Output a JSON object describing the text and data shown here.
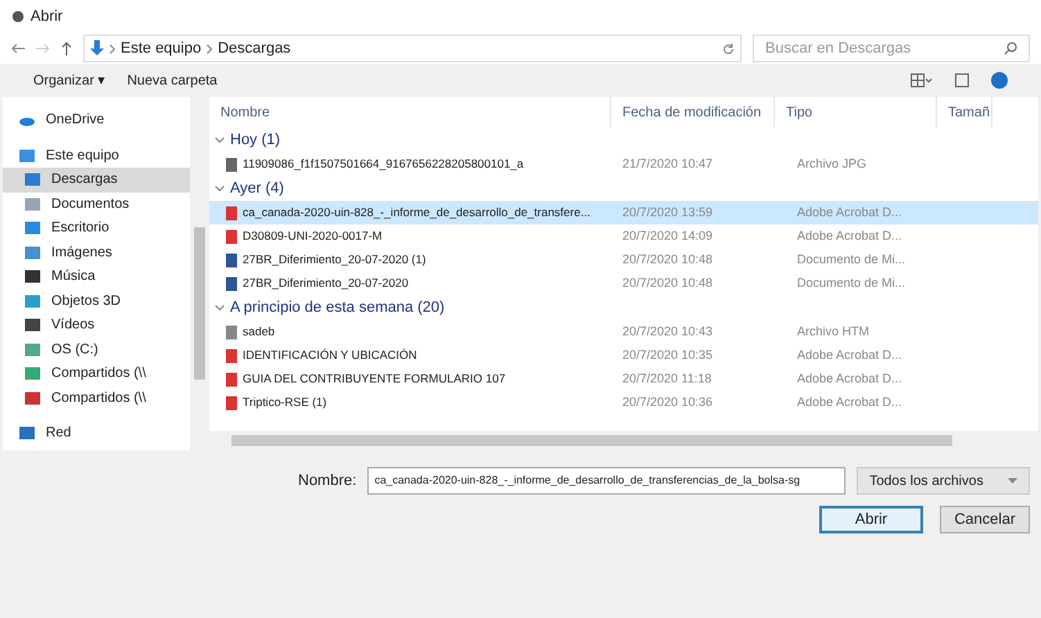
{
  "window": {
    "title": "Abrir"
  },
  "address": {
    "path": [
      "Este equipo",
      "Descargas"
    ],
    "search_placeholder": "Buscar en Descargas"
  },
  "toolbar": {
    "organize": "Organizar ▾",
    "new_folder": "Nueva carpeta"
  },
  "sidebar": {
    "items": [
      {
        "label": "OneDrive",
        "kind": "cloud",
        "selected": false
      },
      {
        "label": "Este equipo",
        "kind": "pc",
        "selected": false
      },
      {
        "label": "Descargas",
        "kind": "download",
        "selected": true
      },
      {
        "label": "Documentos",
        "kind": "doc",
        "selected": false
      },
      {
        "label": "Escritorio",
        "kind": "desk",
        "selected": false
      },
      {
        "label": "Imágenes",
        "kind": "img",
        "selected": false
      },
      {
        "label": "Música",
        "kind": "music",
        "selected": false
      },
      {
        "label": "Objetos 3D",
        "kind": "obj",
        "selected": false
      },
      {
        "label": "Vídeos",
        "kind": "video",
        "selected": false
      },
      {
        "label": "OS (C:)",
        "kind": "disk",
        "selected": false
      },
      {
        "label": "Compartidos (\\\\",
        "kind": "share",
        "selected": false
      },
      {
        "label": "Compartidos (\\\\",
        "kind": "share2",
        "selected": false
      },
      {
        "label": "Red",
        "kind": "net",
        "selected": false
      }
    ]
  },
  "table": {
    "columns": [
      "Nombre",
      "Fecha de modificación",
      "Tipo",
      "Tamañ"
    ],
    "groups": [
      {
        "label": "Hoy (1)",
        "rows": [
          {
            "kind": "jpg",
            "name": "11909086_f1f1507501664_9167656228205800101_a",
            "date": "21/7/2020 10:47",
            "type": "Archivo JPG",
            "selected": false
          }
        ]
      },
      {
        "label": "Ayer (4)",
        "rows": [
          {
            "kind": "pdf",
            "name": "ca_canada-2020-uin-828_-_informe_de_desarrollo_de_transfere...",
            "date": "20/7/2020 13:59",
            "type": "Adobe Acrobat D...",
            "selected": true
          },
          {
            "kind": "pdf",
            "name": "D30809-UNI-2020-0017-M",
            "date": "20/7/2020 14:09",
            "type": "Adobe Acrobat D...",
            "selected": false
          },
          {
            "kind": "word",
            "name": "27BR_Diferimiento_20-07-2020 (1)",
            "date": "20/7/2020 10:48",
            "type": "Documento de Mi...",
            "selected": false
          },
          {
            "kind": "word",
            "name": "27BR_Diferimiento_20-07-2020",
            "date": "20/7/2020 10:48",
            "type": "Documento de Mi...",
            "selected": false
          }
        ]
      },
      {
        "label": "A principio de esta semana (20)",
        "rows": [
          {
            "kind": "htm",
            "name": "sadeb",
            "date": "20/7/2020 10:43",
            "type": "Archivo HTM",
            "selected": false
          },
          {
            "kind": "pdf",
            "name": "IDENTIFICACIÓN Y UBICACIÓN",
            "date": "20/7/2020 10:35",
            "type": "Adobe Acrobat D...",
            "selected": false
          },
          {
            "kind": "pdf",
            "name": "GUIA DEL CONTRIBUYENTE FORMULARIO 107",
            "date": "20/7/2020 11:18",
            "type": "Adobe Acrobat D...",
            "selected": false
          },
          {
            "kind": "pdf",
            "name": "Triptico-RSE (1)",
            "date": "20/7/2020 10:36",
            "type": "Adobe Acrobat D...",
            "selected": false
          }
        ]
      }
    ]
  },
  "footer": {
    "name_label": "Nombre:",
    "name_value": "ca_canada-2020-uin-828_-_informe_de_desarrollo_de_transferencias_de_la_bolsa-sg",
    "filter": "Todos los archivos",
    "open": "Abrir",
    "cancel": "Cancelar"
  }
}
